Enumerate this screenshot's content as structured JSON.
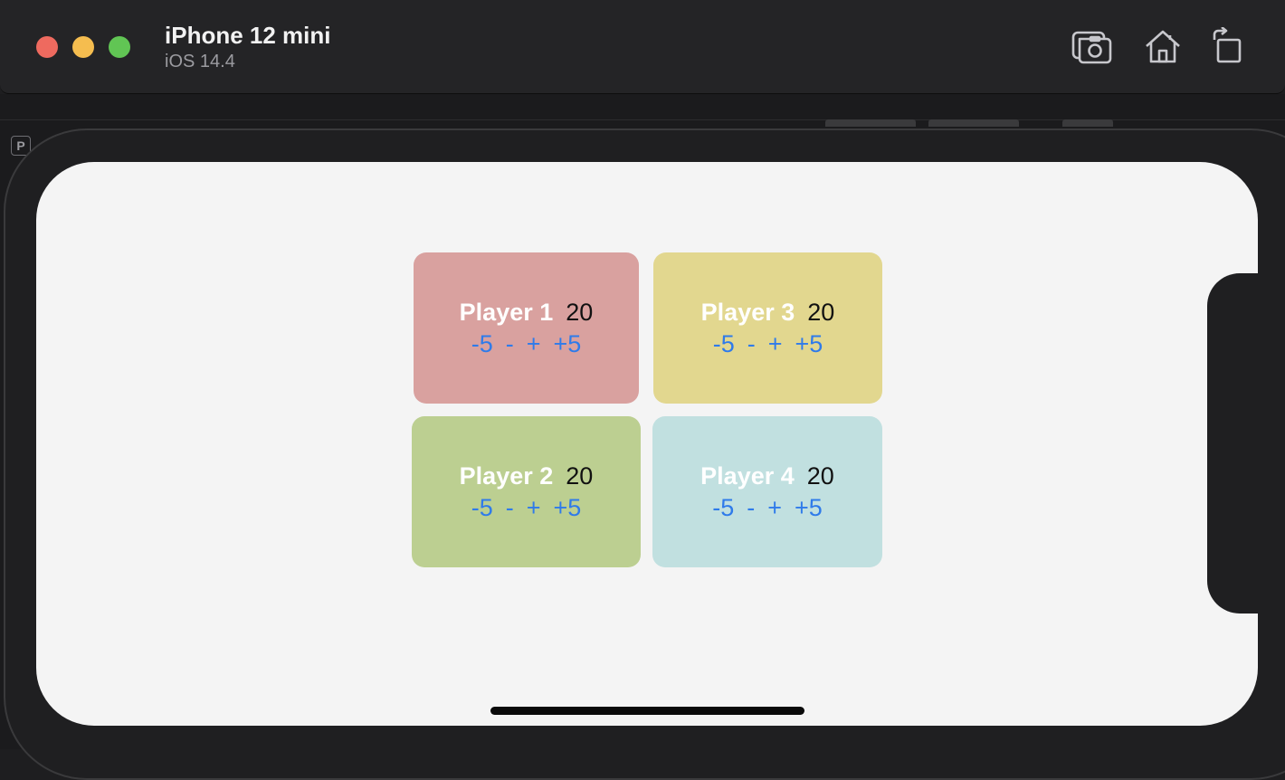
{
  "window": {
    "device_name": "iPhone 12 mini",
    "os_version": "iOS 14.4",
    "controls": [
      "close",
      "minimize",
      "zoom"
    ],
    "toolbar_icons": [
      "screenshot-icon",
      "home-icon",
      "rotate-icon"
    ]
  },
  "backdrop": {
    "badge": "P"
  },
  "colors": {
    "player1": "#d9a19f",
    "player2": "#bccf91",
    "player3": "#e2d78f",
    "player4": "#c1e0e0",
    "button": "#2f7bea"
  },
  "players": [
    {
      "name": "Player 1",
      "score": "20",
      "minus5": "-5",
      "minus": "-",
      "plus": "+",
      "plus5": "+5"
    },
    {
      "name": "Player 2",
      "score": "20",
      "minus5": "-5",
      "minus": "-",
      "plus": "+",
      "plus5": "+5"
    },
    {
      "name": "Player 3",
      "score": "20",
      "minus5": "-5",
      "minus": "-",
      "plus": "+",
      "plus5": "+5"
    },
    {
      "name": "Player 4",
      "score": "20",
      "minus5": "-5",
      "minus": "-",
      "plus": "+",
      "plus5": "+5"
    }
  ]
}
